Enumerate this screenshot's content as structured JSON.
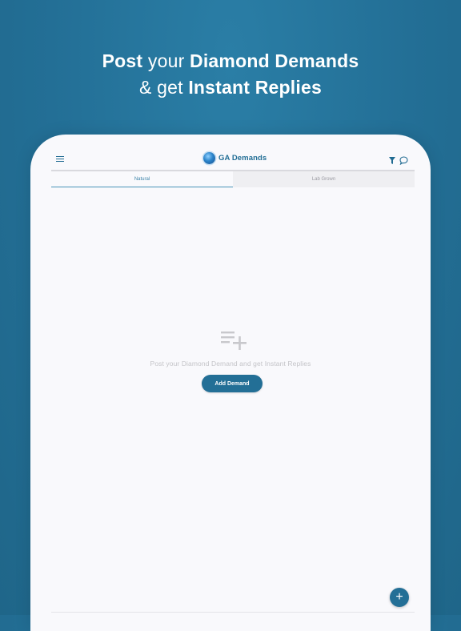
{
  "headline": {
    "line1_bold1": "Post",
    "line1_light": " your ",
    "line1_bold2": "Diamond Demands",
    "line2_light": "& get ",
    "line2_bold": "Instant Replies"
  },
  "appbar": {
    "logo_text": "GA Demands",
    "icons": [
      "menu-icon",
      "globe-logo",
      "filter-icon",
      "chat-icon"
    ]
  },
  "tabs": [
    {
      "label": "Natural",
      "active": true
    },
    {
      "label": "Lab Grown",
      "active": false
    }
  ],
  "empty_state": {
    "icon": "playlist-add-icon",
    "message": "Post your Diamond Demand and get Instant Replies",
    "button_label": "Add Demand"
  },
  "fab": {
    "label": "+",
    "icon": "plus-icon"
  },
  "colors": {
    "background": "#236f96",
    "accent": "#236f96",
    "screen": "#f9f9fc",
    "muted_text": "#c4c4c8"
  }
}
